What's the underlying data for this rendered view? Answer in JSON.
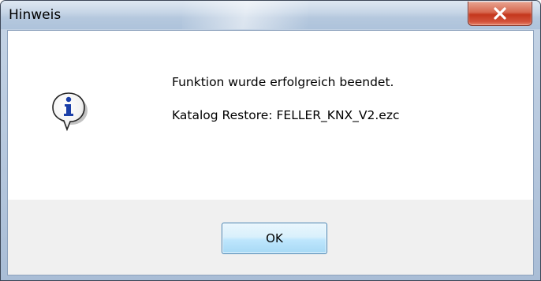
{
  "dialog": {
    "title": "Hinweis",
    "close_icon": "close-x-icon",
    "message_icon": "information-icon",
    "message_lines": [
      "Funktion wurde erfolgreich beendet.",
      "Katalog Restore: FELLER_KNX_V2.ezc"
    ],
    "ok_label": "OK"
  },
  "colors": {
    "close_button": "#c4371d",
    "ok_button_border": "#3c7fb1",
    "info_icon_blue": "#1b3fa8",
    "button_area": "#f0f0f0"
  }
}
